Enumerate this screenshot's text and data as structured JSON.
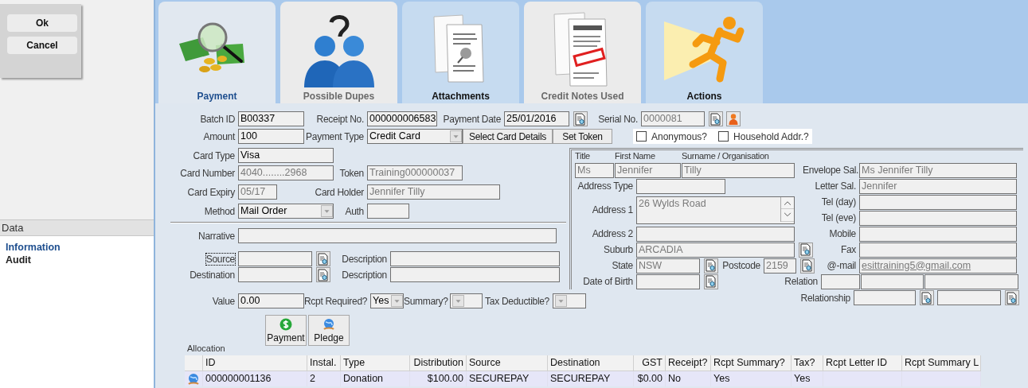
{
  "dialog_buttons": [
    "Ok",
    "Cancel"
  ],
  "sidebar": {
    "header": "Data",
    "items": [
      {
        "label": "Information",
        "selected": true
      },
      {
        "label": "Audit",
        "selected": false
      }
    ]
  },
  "tabs": [
    {
      "label": "Payment",
      "kind": "money",
      "selected": true,
      "disabled": false
    },
    {
      "label": "Possible Dupes",
      "kind": "people",
      "selected": false,
      "disabled": true
    },
    {
      "label": "Attachments",
      "kind": "attachment",
      "selected": false,
      "disabled": false
    },
    {
      "label": "Credit Notes Used",
      "kind": "credit",
      "selected": false,
      "disabled": true
    },
    {
      "label": "Actions",
      "kind": "runner",
      "selected": false,
      "disabled": false
    }
  ],
  "payment": {
    "batch_id": {
      "label": "Batch ID",
      "value": "B00337",
      "disabled": false
    },
    "receipt_no": {
      "label": "Receipt No.",
      "value": "000000006583",
      "disabled": false
    },
    "payment_date": {
      "label": "Payment Date",
      "value": "25/01/2016",
      "disabled": false
    },
    "serial_no": {
      "label": "Serial No.",
      "value": "0000081",
      "disabled": true
    },
    "amount": {
      "label": "Amount",
      "value": "100",
      "disabled": false
    },
    "payment_type": {
      "label": "Payment Type",
      "value": "Credit Card",
      "disabled": false
    },
    "card_buttons": [
      "Select Card Details",
      "Set Token"
    ],
    "checkboxes": [
      {
        "label": "Anonymous?",
        "checked": false
      },
      {
        "label": "Household Addr.?",
        "checked": false
      }
    ],
    "card_type": {
      "label": "Card Type",
      "value": "Visa",
      "disabled": false
    },
    "card_number": {
      "label": "Card Number",
      "value": "4040........2968",
      "disabled": true
    },
    "token": {
      "label": "Token",
      "value": "Training000000037",
      "disabled": true
    },
    "card_expiry": {
      "label": "Card Expiry",
      "value": "05/17",
      "disabled": true
    },
    "card_holder": {
      "label": "Card Holder",
      "value": "Jennifer Tilly",
      "disabled": true
    },
    "method": {
      "label": "Method",
      "value": "Mail Order",
      "disabled": false
    },
    "auth": {
      "label": "Auth"
    },
    "narrative": {
      "label": "Narrative"
    },
    "source": {
      "label": "Source",
      "focused": true
    },
    "source_description": {
      "label": "Description"
    },
    "destination": {
      "label": "Destination",
      "focused": false
    },
    "destination_description": {
      "label": "Description"
    },
    "value": {
      "label": "Value",
      "value": "0.00",
      "disabled": false
    },
    "rcpt_required": {
      "label": "Rcpt Required?",
      "value": "Yes"
    },
    "summary": {
      "label": "Summary?"
    },
    "tax_deductible": {
      "label": "Tax Deductible?"
    },
    "action_buttons": [
      {
        "label": "Payment",
        "kind": "dollar"
      },
      {
        "label": "Pledge",
        "kind": "globe"
      }
    ],
    "allocation_label": "Allocation"
  },
  "contact": {
    "disabled": true,
    "name_headers": [
      "Title",
      "First Name",
      "Surname / Organisation"
    ],
    "name_values": [
      "Ms",
      "Jennifer",
      "Tilly"
    ],
    "address_type": {
      "label": "Address Type"
    },
    "address_1": {
      "label": "Address 1",
      "value": "26 Wylds Road"
    },
    "address_2": {
      "label": "Address 2"
    },
    "suburb": {
      "label": "Suburb",
      "value": "ARCADIA"
    },
    "state": {
      "label": "State",
      "value": "NSW"
    },
    "postcode": {
      "label": "Postcode",
      "value": "2159"
    },
    "date_of_birth": {
      "label": "Date of Birth"
    },
    "envelope_sal": {
      "label": "Envelope Sal.",
      "value": "Ms Jennifer Tilly"
    },
    "letter_sal": {
      "label": "Letter Sal.",
      "value": "Jennifer"
    },
    "tel_day": {
      "label": "Tel (day)"
    },
    "tel_eve": {
      "label": "Tel (eve)"
    },
    "mobile": {
      "label": "Mobile"
    },
    "fax": {
      "label": "Fax"
    },
    "email": {
      "label": "@-mail",
      "value": "esittraining5@gmail.com",
      "link": true
    },
    "relation": {
      "label": "Relation"
    },
    "relationship": {
      "label": "Relationship"
    }
  },
  "allocation_table": {
    "columns": [
      "ID",
      "Instal.",
      "Type",
      "Distribution",
      "Source",
      "Destination",
      "GST",
      "Receipt?",
      "Rcpt Summary?",
      "Tax?",
      "Rcpt Letter ID",
      "Rcpt Summary L"
    ],
    "rows": [
      {
        "selected": true,
        "cells": [
          "000000001136",
          "2",
          "Donation",
          "$100.00",
          "SECUREPAY",
          "SECUREPAY",
          "$0.00",
          "No",
          "Yes",
          "Yes"
        ]
      }
    ]
  }
}
